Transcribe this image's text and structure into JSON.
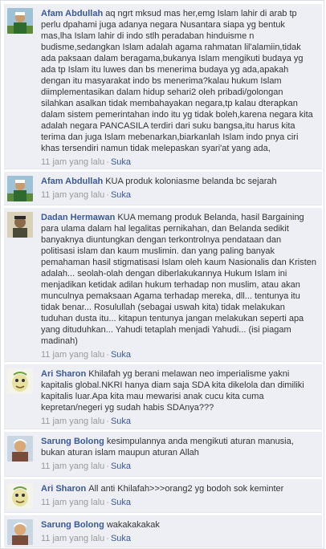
{
  "comments": [
    {
      "author": "Afam Abdullah",
      "text": "aq ngrt mksud mas her,emg Islam lahir di arab tp perlu dpahami juga adanya negara Nusantara siapa yg bentuk mas,lha Islam lahir di indo stlh peradaban hinduisme n budisme,sedangkan Islam adalah agama rahmatan lil'alamiin,tidak ada paksaan dalam beragama,bukanya Islam mengikuti budaya yg ada tp Islam itu luwes dan bs menerima budaya yg ada,apakah dengan itu masyarakat indo bs menerima?kalau hukum Islam diimplementasikan dalam hidup sehari2 oleh pribadi/golongan silahkan asalkan tidak membahayakan negara,tp kalau dterapkan dalam sistem pemerintahan indo itu yg tidak boleh,karena negara kita adalah negara PANCASILA terdiri dari suku bangsa,itu harus kita terima dan juga Islam mebenarkan,biarkanlah Islam indo pnya ciri khas tersendiri namun tidak melepaskan syari'at yang ada,",
      "time": "11 jam yang lalu",
      "like": "Suka",
      "avatar": "afam-avatar"
    },
    {
      "author": "Afam Abdullah",
      "text": "KUA produk koloniasme belanda bc sejarah",
      "time": "11 jam yang lalu",
      "like": "Suka",
      "avatar": "afam-avatar"
    },
    {
      "author": "Dadan Hermawan",
      "text": "KUA memang produk Belanda, hasil Bargaining para ulama dalam hal legalitas pernikahan, dan Belanda sedikit banyaknya diuntungkan dengan terkontrolnya pendataan dan politisasi islam dan kaum muslimin. dan yang paling banyak pemahaman hasil stigmatisasi Islam oleh kaum Nasionalis dan Kristen adalah... seolah-olah dengan diberlakukannya Hukum Islam ini menjadikan ketidak adilan hukum terhadap non muslim, atau akan munculnya pemaksaan Agama terhadap mereka, dll... tentunya itu tidak benar... Rosulullah (sebagai uswah kita) tidak melakukan tuduhan dusta itu... kitapun tentunya jangan melakukan seperti apa yang dituduhkan... Yahudi tetaplah menjadi Yahudi... (isi piagam madinah)",
      "time": "11 jam yang lalu",
      "like": "Suka",
      "avatar": "dadan-avatar"
    },
    {
      "author": "Ari Sharon",
      "text": "Khilafah yg berani melawan neo imperialisme yakni kapitalis global.NKRI hanya diam saja SDA kita dikelola dan dimiliki kapitalis luar.Apa kita mau mewarisi anak cucu kita cuma kepretan/negeri yg sudah habis SDAnya???",
      "time": "11 jam yang lalu",
      "like": "Suka",
      "avatar": "ari-avatar"
    },
    {
      "author": "Sarung Bolong",
      "text": "kesimpulannya anda mengikuti aturan manusia, bukan aturan islam maupun aturan Allah",
      "time": "11 jam yang lalu",
      "like": "Suka",
      "avatar": "sarung-avatar"
    },
    {
      "author": "Ari Sharon",
      "text": "All anti Khilafah>>>orang2 yg bodoh sok keminter",
      "time": "11 jam yang lalu",
      "like": "Suka",
      "avatar": "ari-avatar"
    },
    {
      "author": "Sarung Bolong",
      "text": "wakakakakak",
      "time": "11 jam yang lalu",
      "like": "Suka",
      "avatar": "sarung-avatar"
    }
  ],
  "separator": "·",
  "colors": {
    "link": "#3b5998",
    "background": "#edeff4",
    "meta": "#999999"
  }
}
